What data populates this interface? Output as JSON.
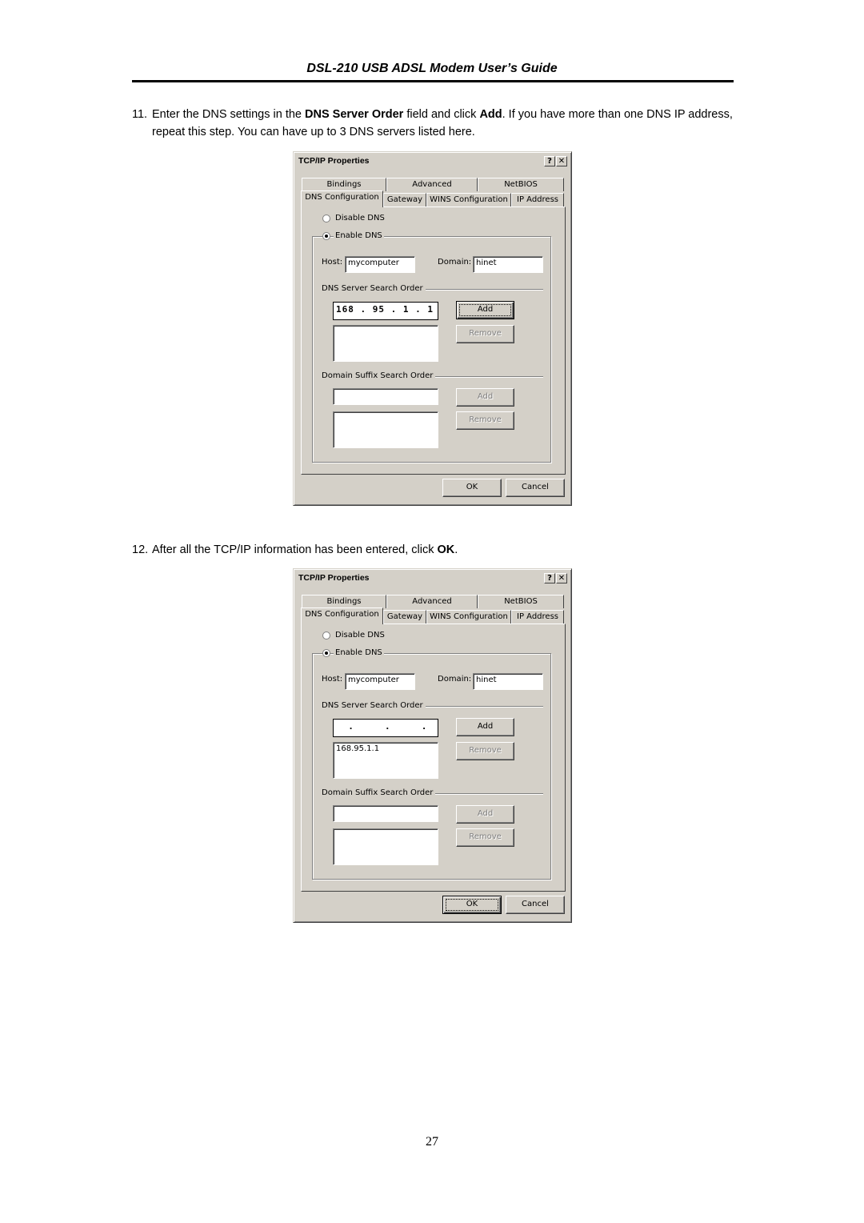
{
  "page": {
    "header_title": "DSL-210 USB ADSL Modem User’s Guide",
    "page_number": "27"
  },
  "steps": [
    {
      "number": "11.",
      "parts": [
        "Enter the DNS settings in the ",
        "DNS Server Order",
        " field and click ",
        "Add",
        ". If you have more than one DNS IP address, repeat this step. You can have up to 3 DNS servers listed here."
      ]
    },
    {
      "number": "12.",
      "parts": [
        "After all the TCP/IP information has been entered, click ",
        "OK",
        "."
      ]
    }
  ],
  "dialogs": [
    {
      "title": "TCP/IP Properties",
      "help_button": "?",
      "close_button": "✕",
      "tabs_row1": [
        "Bindings",
        "Advanced",
        "NetBIOS"
      ],
      "tabs_row2": [
        "DNS Configuration",
        "Gateway",
        "WINS Configuration",
        "IP Address"
      ],
      "active_tab": "DNS Configuration",
      "disable_dns_label": "Disable DNS",
      "enable_dns_label": "Enable DNS",
      "dns_enabled": true,
      "host_label": "Host:",
      "host_value": "mycomputer",
      "domain_label": "Domain:",
      "domain_value": "hinet",
      "dns_server_group": "DNS Server Search Order",
      "dns_ip_input": "168 . 95 . 1 . 1",
      "dns_list": "",
      "add_label": "Add",
      "remove_label": "Remove",
      "suffix_group": "Domain Suffix Search Order",
      "suffix_input": "",
      "suffix_list": "",
      "suffix_add_label": "Add",
      "suffix_remove_label": "Remove",
      "ok_label": "OK",
      "cancel_label": "Cancel"
    },
    {
      "title": "TCP/IP Properties",
      "help_button": "?",
      "close_button": "✕",
      "tabs_row1": [
        "Bindings",
        "Advanced",
        "NetBIOS"
      ],
      "tabs_row2": [
        "DNS Configuration",
        "Gateway",
        "WINS Configuration",
        "IP Address"
      ],
      "active_tab": "DNS Configuration",
      "disable_dns_label": "Disable DNS",
      "enable_dns_label": "Enable DNS",
      "dns_enabled": true,
      "host_label": "Host:",
      "host_value": "mycomputer",
      "domain_label": "Domain:",
      "domain_value": "hinet",
      "dns_server_group": "DNS Server Search Order",
      "dns_ip_input": "  .     .     .  ",
      "dns_list": "168.95.1.1",
      "add_label": "Add",
      "remove_label": "Remove",
      "suffix_group": "Domain Suffix Search Order",
      "suffix_input": "",
      "suffix_list": "",
      "suffix_add_label": "Add",
      "suffix_remove_label": "Remove",
      "ok_label": "OK",
      "cancel_label": "Cancel"
    }
  ]
}
